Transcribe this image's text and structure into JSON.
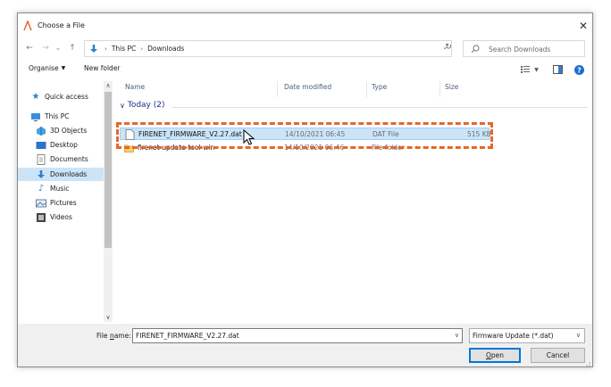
{
  "window": {
    "title": "Choose a File",
    "close_glyph": "✕"
  },
  "navbar": {
    "back_glyph": "←",
    "forward_glyph": "→",
    "recent_glyph": "⌄",
    "up_glyph": "↑",
    "breadcrumbs": [
      "This PC",
      "Downloads"
    ],
    "breadcrumb_sep": "›",
    "refresh_glyph": "↻",
    "search_placeholder": "Search Downloads"
  },
  "toolbar": {
    "organise": "Organise",
    "new_folder": "New folder"
  },
  "nav_pane": {
    "items": [
      {
        "label": "Quick access",
        "icon": "star-icon"
      },
      {
        "label": "This PC",
        "icon": "computer-icon"
      },
      {
        "label": "3D Objects",
        "icon": "cube-icon"
      },
      {
        "label": "Desktop",
        "icon": "desktop-icon"
      },
      {
        "label": "Documents",
        "icon": "document-icon"
      },
      {
        "label": "Downloads",
        "icon": "download-icon"
      },
      {
        "label": "Music",
        "icon": "music-icon"
      },
      {
        "label": "Pictures",
        "icon": "picture-icon"
      },
      {
        "label": "Videos",
        "icon": "video-icon"
      }
    ],
    "selected": "Downloads"
  },
  "file_list": {
    "columns": [
      "Name",
      "Date modified",
      "Type",
      "Size"
    ],
    "group": {
      "label": "Today (2)",
      "chevron": "∨"
    },
    "rows": [
      {
        "name": "FIRENET_FIRMWARE_V2.27.dat",
        "date": "14/10/2021 06:45",
        "type": "DAT File",
        "size": "515 KB",
        "icon": "file-icon",
        "selected": true
      },
      {
        "name": "firenet-update-tool-win",
        "date": "14/10/2021 06:46",
        "type": "File folder",
        "size": "",
        "icon": "folder-icon",
        "selected": false
      }
    ]
  },
  "bottom": {
    "file_name_label_pre": "File ",
    "file_name_label_u": "n",
    "file_name_label_post": "ame:",
    "file_name_value": "FIRENET_FIRMWARE_V2.27.dat",
    "file_type_value": "Firmware Update (*.dat)",
    "open_label_u": "O",
    "open_label_rest": "pen",
    "cancel_label": "Cancel"
  },
  "colors": {
    "accent": "#0078d7",
    "highlight": "#e8652d",
    "selection": "#cce4f7"
  }
}
